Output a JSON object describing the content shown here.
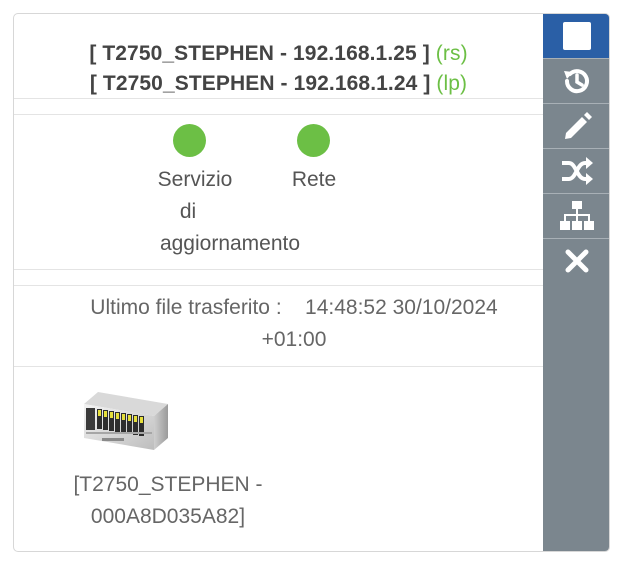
{
  "header": {
    "line1": {
      "text": "[ T2750_STEPHEN - 192.168.1.25 ]",
      "tag": "(rs)"
    },
    "line2": {
      "text": "[ T2750_STEPHEN - 192.168.1.24 ]",
      "tag": "(lp)"
    }
  },
  "status": {
    "update_service": {
      "label_line1": "Servizio",
      "label_line2": "di",
      "label_line3": "aggiornamento",
      "state": "ok"
    },
    "network": {
      "label": "Rete",
      "state": "ok"
    }
  },
  "transfer": {
    "label": "Ultimo file trasferito :",
    "value": "14:48:52 30/10/2024",
    "tz": "+01:00"
  },
  "device": {
    "name_line1": "[T2750_STEPHEN -",
    "name_line2": "000A8D035A82]",
    "icon": "plc-controller-image"
  },
  "sidebar": {
    "buttons": [
      {
        "icon": "stop-square-icon",
        "active": true
      },
      {
        "icon": "history-icon",
        "active": false
      },
      {
        "icon": "pencil-icon",
        "active": false
      },
      {
        "icon": "shuffle-icon",
        "active": false
      },
      {
        "icon": "sitemap-icon",
        "active": false
      },
      {
        "icon": "close-icon",
        "active": false
      }
    ]
  },
  "colors": {
    "sidebar_bg": "#7b868e",
    "active_bg": "#2a5fa6",
    "status_green": "#6cbf45",
    "tag_green": "#6cbf45"
  }
}
